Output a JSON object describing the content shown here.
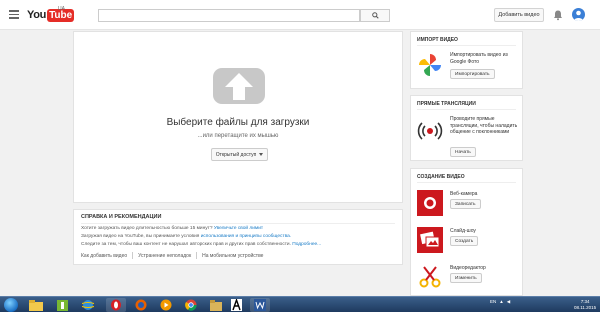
{
  "header": {
    "logo_you": "You",
    "logo_tube": "Tube",
    "logo_region": "UA",
    "upload_button": "Добавить видео",
    "search_icon": "search-icon",
    "bell_icon": "bell-icon"
  },
  "upload": {
    "title": "Выберите файлы для загрузки",
    "subtitle": "...или перетащите их мышью",
    "privacy_label": "Открытый доступ"
  },
  "help": {
    "title": "СПРАВКА И РЕКОМЕНДАЦИИ",
    "line1_text": "Хотите загружать видео длительностью больше 15 минут? ",
    "line1_link": "Увеличьте свой лимит",
    "line2_text": "Загружая видео на YouTube, вы принимаете условия ",
    "line2_link": "использования и принципы сообщества.",
    "line3_text": "Следите за тем, чтобы ваш контент не нарушал авторских прав и других прав собственности. ",
    "line3_link": "Подробнее...",
    "links": [
      "Как добавить видео",
      "Устранение неполадок",
      "На мобильном устройстве"
    ]
  },
  "import": {
    "title": "ИМПОРТ ВИДЕО",
    "text": "Импортировать видео из Google Фото",
    "button": "Импортировать"
  },
  "live": {
    "title": "ПРЯМЫЕ ТРАНСЛЯЦИИ",
    "text": "Проводите прямые трансляции, чтобы наладить общение с поклонниками",
    "button": "Начать"
  },
  "create": {
    "title": "СОЗДАНИЕ ВИДЕО",
    "items": [
      {
        "label": "Веб-камера",
        "button": "Записать"
      },
      {
        "label": "Слайд-шоу",
        "button": "Создать"
      },
      {
        "label": "Видеоредактор",
        "button": "Изменить"
      }
    ]
  },
  "taskbar": {
    "tray_lang": "EN",
    "time": "7:34",
    "date": "08.11.2015"
  },
  "colors": {
    "brand_red": "#e52d27",
    "link_blue": "#167ac6"
  }
}
